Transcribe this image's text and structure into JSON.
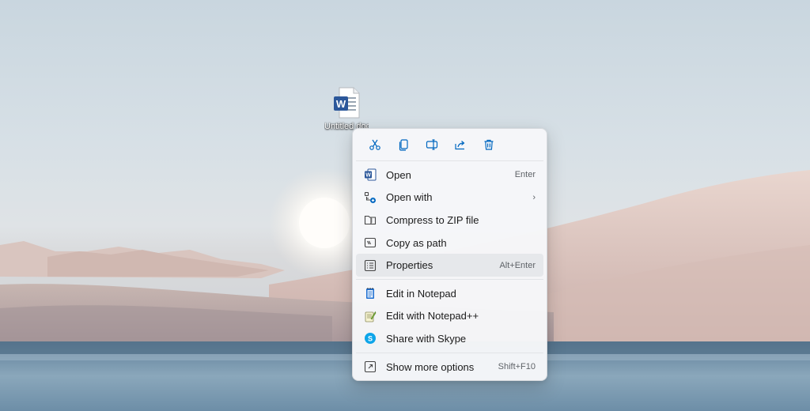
{
  "desktop": {
    "icon": {
      "name": "word-document-icon",
      "label": "Untitled document"
    }
  },
  "colors": {
    "accent": "#0067c0",
    "word_blue": "#2b579a",
    "menu_bg": "#f6f7f9",
    "hover_bg": "#e6e8eb"
  },
  "context_menu": {
    "quick_actions": [
      {
        "name": "cut-icon",
        "label": "Cut"
      },
      {
        "name": "copy-icon",
        "label": "Copy"
      },
      {
        "name": "rename-icon",
        "label": "Rename"
      },
      {
        "name": "share-icon",
        "label": "Share"
      },
      {
        "name": "delete-icon",
        "label": "Delete"
      }
    ],
    "items": [
      {
        "label": "Open",
        "accel": "Enter",
        "icon": "word-icon"
      },
      {
        "label": "Open with",
        "accel": "",
        "icon": "open-with-icon",
        "submenu": true
      },
      {
        "label": "Compress to ZIP file",
        "accel": "",
        "icon": "zip-folder-icon"
      },
      {
        "label": "Copy as path",
        "accel": "",
        "icon": "copy-path-icon"
      },
      {
        "label": "Properties",
        "accel": "Alt+Enter",
        "icon": "properties-icon",
        "hover": true
      },
      {
        "label": "Edit in Notepad",
        "accel": "",
        "icon": "notepad-icon"
      },
      {
        "label": "Edit with Notepad++",
        "accel": "",
        "icon": "notepad-plus-plus-icon"
      },
      {
        "label": "Share with Skype",
        "accel": "",
        "icon": "skype-icon"
      },
      {
        "label": "Show more options",
        "accel": "Shift+F10",
        "icon": "more-options-icon"
      }
    ]
  }
}
